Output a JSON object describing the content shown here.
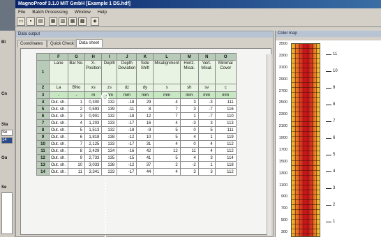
{
  "app": {
    "title": "MagnoProof 3.1.0   MIT GmbH  [Example 1 DS.hdf]",
    "menu": [
      "File",
      "Batch Processing",
      "Window",
      "Help"
    ]
  },
  "left_strip": {
    "labels": [
      "Bl",
      "Cn",
      "Sta",
      "Ou",
      "Se"
    ],
    "fields": [
      "Se",
      "14"
    ]
  },
  "panel": {
    "title": "Data output",
    "tabs": [
      "Coordinates",
      "Quick Check",
      "Data sheet"
    ],
    "active_tab": "Data sheet"
  },
  "sheet": {
    "columns": [
      "F",
      "G",
      "H",
      "I",
      "J",
      "K",
      "L",
      "M",
      "N",
      "O"
    ],
    "header_row": [
      "Lane",
      "Bar No.",
      "X-Position",
      "Depth",
      "Depth Deviation",
      "Side Shift",
      "Misalignment",
      "Horiz. Misal.",
      "Vert. Misal.",
      "Minimal Cover"
    ],
    "symbols": [
      "La",
      "BNo",
      "xs",
      "zs",
      "dz",
      "dy",
      "s",
      "sh",
      "sv",
      "c"
    ],
    "units": [
      "-",
      "-",
      "m",
      "mm",
      "mm",
      "mm",
      "mm",
      "mm",
      "mm",
      "mm"
    ],
    "row_numbers": [
      "1",
      "2",
      "3",
      "4",
      "5",
      "6",
      "7",
      "8",
      "9",
      "10",
      "11",
      "12",
      "13",
      "14"
    ],
    "rows": [
      [
        "Out. sh.",
        "1",
        "0,300",
        "132",
        "-18",
        "29",
        "4",
        "3",
        "-3",
        "111"
      ],
      [
        "Out. sh.",
        "2",
        "0,593",
        "139",
        "-11",
        "8",
        "7",
        "3",
        "-7",
        "116"
      ],
      [
        "Out. sh.",
        "3",
        "0,901",
        "132",
        "-18",
        "12",
        "7",
        "1",
        "-7",
        "110"
      ],
      [
        "Out. sh.",
        "4",
        "1,203",
        "133",
        "-17",
        "16",
        "4",
        "-3",
        "3",
        "113"
      ],
      [
        "Out. sh.",
        "5",
        "1,513",
        "132",
        "-18",
        "-9",
        "5",
        "0",
        "5",
        "111"
      ],
      [
        "Out. sh.",
        "6",
        "1,818",
        "138",
        "-12",
        "10",
        "5",
        "4",
        "1",
        "119"
      ],
      [
        "Out. sh.",
        "7",
        "2,125",
        "133",
        "-17",
        "31",
        "4",
        "0",
        "4",
        "112"
      ],
      [
        "Out. sh.",
        "8",
        "2,429",
        "134",
        "-16",
        "42",
        "12",
        "11",
        "4",
        "112"
      ],
      [
        "Out. sh.",
        "9",
        "2,733",
        "135",
        "-15",
        "41",
        "5",
        "4",
        "3",
        "114"
      ],
      [
        "Out. sh.",
        "10",
        "3,033",
        "138",
        "-12",
        "37",
        "2",
        "-2",
        "1",
        "118"
      ],
      [
        "Out. sh.",
        "11",
        "3,341",
        "133",
        "-17",
        "44",
        "4",
        "3",
        "3",
        "112"
      ]
    ]
  },
  "map": {
    "title": "Color map",
    "y_ticks": [
      "3500",
      "3300",
      "3100",
      "2900",
      "2700",
      "2500",
      "2300",
      "2100",
      "1900",
      "1700",
      "1500",
      "1300",
      "1100",
      "900",
      "700",
      "500",
      "300"
    ],
    "bar_labels": [
      "11",
      "10",
      "9",
      "8",
      "7",
      "6",
      "5",
      "4",
      "3",
      "2",
      "1"
    ]
  },
  "colors": {
    "title_bar": "#0a246a",
    "header_green": "#b8cbb8",
    "unit_green": "#c7e6c2",
    "heat_red": "#c2111a",
    "heat_yellow": "#f4d23a"
  }
}
